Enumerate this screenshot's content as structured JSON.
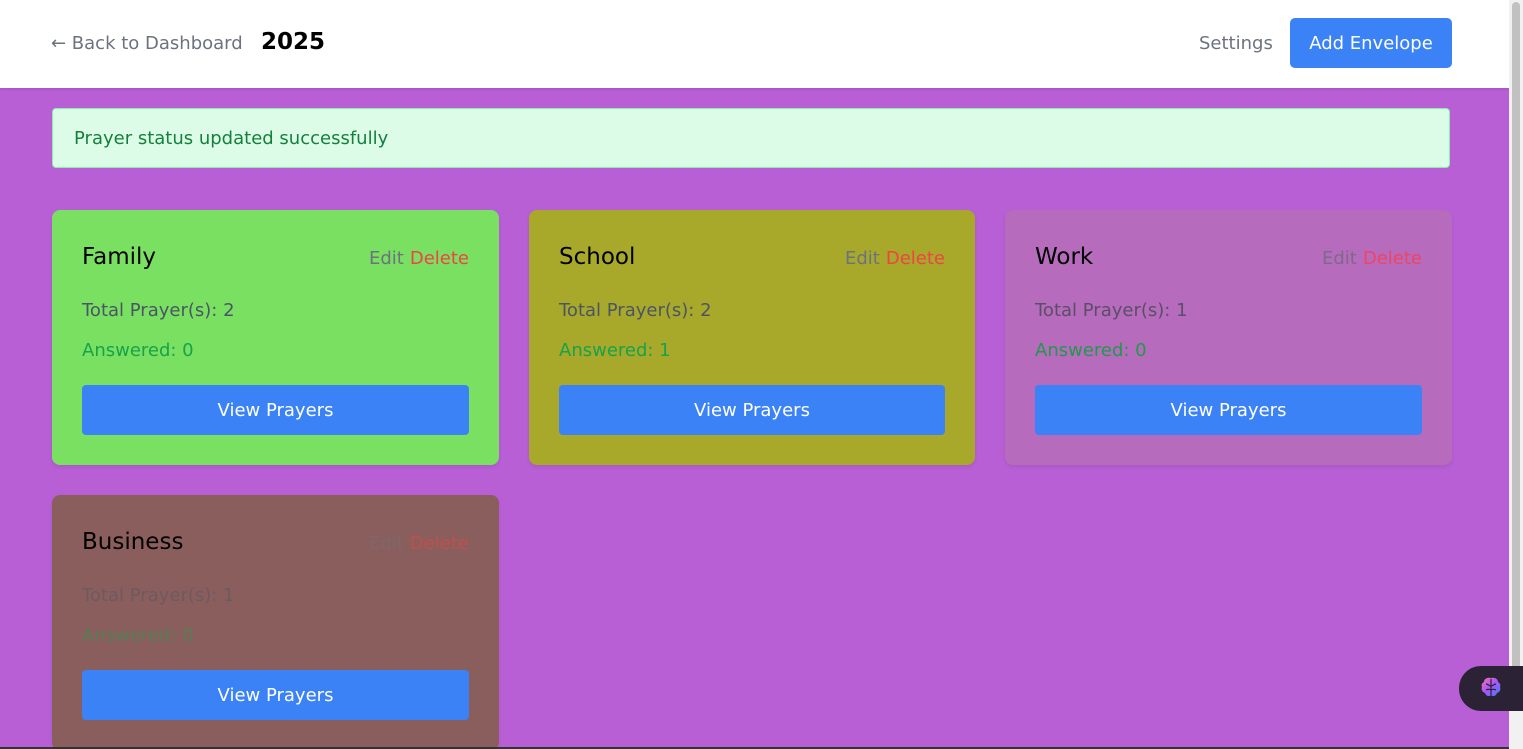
{
  "header": {
    "back_label": "← Back to Dashboard",
    "title": "2025",
    "settings_label": "Settings",
    "add_button_label": "Add Envelope"
  },
  "alert": {
    "message": "Prayer status updated successfully"
  },
  "colors": {
    "page_background": "#b85fd6",
    "primary_button": "#3b82f6",
    "delete_text": "#ef4444",
    "answered_text": "#16a34a"
  },
  "envelopes": [
    {
      "name": "Family",
      "color": "#7ae062",
      "edit_label": "Edit",
      "delete_label": "Delete",
      "total_text": "Total Prayer(s): 2",
      "answered_text": "Answered: 0",
      "view_label": "View Prayers"
    },
    {
      "name": "School",
      "color": "#a8a82b",
      "edit_label": "Edit",
      "delete_label": "Delete",
      "total_text": "Total Prayer(s): 2",
      "answered_text": "Answered: 1",
      "view_label": "View Prayers"
    },
    {
      "name": "Work",
      "color": "#b66bbd",
      "edit_label": "Edit",
      "delete_label": "Delete",
      "total_text": "Total Prayer(s): 1",
      "answered_text": "Answered: 0",
      "view_label": "View Prayers"
    },
    {
      "name": "Business",
      "color": "#8b5e5e",
      "edit_label": "Edit",
      "delete_label": "Delete",
      "total_text": "Total Prayer(s): 1",
      "answered_text": "Answered: 0",
      "view_label": "View Prayers"
    }
  ],
  "floating_button": {
    "icon": "brain-icon"
  }
}
